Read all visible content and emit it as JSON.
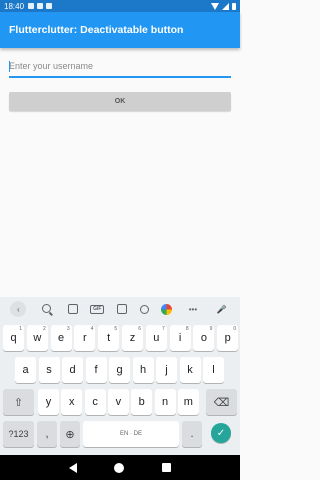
{
  "status_bar": {
    "time": "18:40"
  },
  "app_bar": {
    "title": "Flutterclutter: Deactivatable button"
  },
  "form": {
    "username_placeholder": "Enter your username",
    "username_value": "",
    "ok_label": "OK",
    "ok_enabled": false
  },
  "keyboard": {
    "toolbar": {
      "back": "‹",
      "gif": "GIF",
      "more": "•••"
    },
    "row1": [
      {
        "k": "q",
        "s": "1"
      },
      {
        "k": "w",
        "s": "2"
      },
      {
        "k": "e",
        "s": "3"
      },
      {
        "k": "r",
        "s": "4"
      },
      {
        "k": "t",
        "s": "5"
      },
      {
        "k": "z",
        "s": "6"
      },
      {
        "k": "u",
        "s": "7"
      },
      {
        "k": "i",
        "s": "8"
      },
      {
        "k": "o",
        "s": "9"
      },
      {
        "k": "p",
        "s": "0"
      }
    ],
    "row2": [
      "a",
      "s",
      "d",
      "f",
      "g",
      "h",
      "j",
      "k",
      "l"
    ],
    "row3": [
      "y",
      "x",
      "c",
      "v",
      "b",
      "n",
      "m"
    ],
    "shift": "⇧",
    "backspace": "⌫",
    "symbols": "?123",
    "comma": ",",
    "globe": "⊕",
    "space_label": "EN · DE",
    "period": ".",
    "enter": "✓"
  },
  "colors": {
    "status_bar": "#1c78c8",
    "app_bar": "#2196f3",
    "accent": "#2196f3",
    "button_disabled": "#cfcfcf",
    "enter_key": "#26a69a"
  }
}
